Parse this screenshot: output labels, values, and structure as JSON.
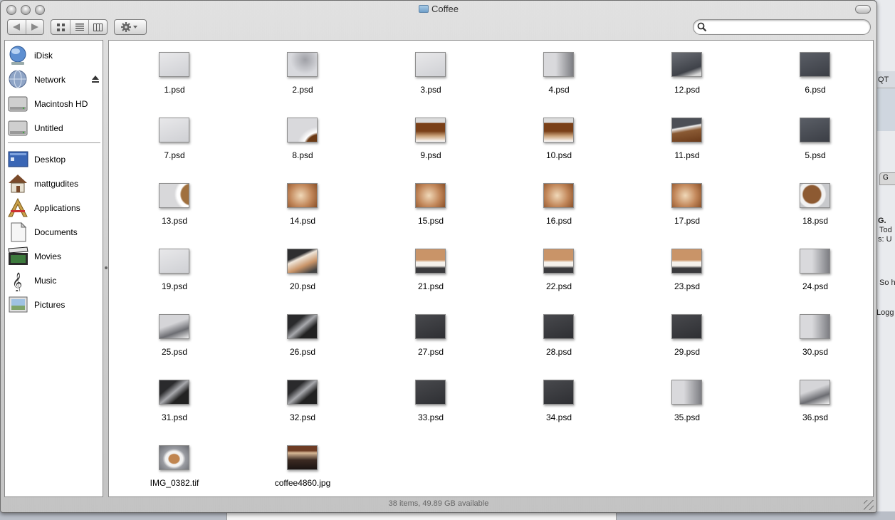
{
  "window": {
    "title": "Coffee",
    "status_text": "38 items, 49.89 GB available"
  },
  "toolbar": {
    "nav_icons": [
      "back-arrow-icon",
      "forward-arrow-icon"
    ],
    "view_icons": [
      "icon-view-icon",
      "list-view-icon",
      "column-view-icon"
    ],
    "action_icon": "gear-icon",
    "search_placeholder": "",
    "search_value": ""
  },
  "sidebar": {
    "devices": [
      {
        "label": "iDisk",
        "icon": "idisk-icon"
      },
      {
        "label": "Network",
        "icon": "network-globe-icon",
        "eject": true
      },
      {
        "label": "Macintosh HD",
        "icon": "hard-drive-icon"
      },
      {
        "label": "Untitled",
        "icon": "hard-drive-icon"
      }
    ],
    "places": [
      {
        "label": "Desktop",
        "icon": "desktop-icon"
      },
      {
        "label": "mattgudites",
        "icon": "home-icon"
      },
      {
        "label": "Applications",
        "icon": "applications-icon"
      },
      {
        "label": "Documents",
        "icon": "documents-icon"
      },
      {
        "label": "Movies",
        "icon": "movies-icon"
      },
      {
        "label": "Music",
        "icon": "music-icon"
      },
      {
        "label": "Pictures",
        "icon": "pictures-icon"
      }
    ]
  },
  "files": [
    {
      "name": "1.psd",
      "tone": "l"
    },
    {
      "name": "2.psd",
      "tone": "l2"
    },
    {
      "name": "3.psd",
      "tone": "l"
    },
    {
      "name": "4.psd",
      "tone": "m"
    },
    {
      "name": "12.psd",
      "tone": "g"
    },
    {
      "name": "6.psd",
      "tone": "d"
    },
    {
      "name": "7.psd",
      "tone": "l"
    },
    {
      "name": "8.psd",
      "tone": "cup"
    },
    {
      "name": "9.psd",
      "tone": "c"
    },
    {
      "name": "10.psd",
      "tone": "c"
    },
    {
      "name": "11.psd",
      "tone": "gc"
    },
    {
      "name": "5.psd",
      "tone": "d"
    },
    {
      "name": "13.psd",
      "tone": "lc"
    },
    {
      "name": "14.psd",
      "tone": "f"
    },
    {
      "name": "15.psd",
      "tone": "f"
    },
    {
      "name": "16.psd",
      "tone": "f"
    },
    {
      "name": "17.psd",
      "tone": "f"
    },
    {
      "name": "18.psd",
      "tone": "fc"
    },
    {
      "name": "19.psd",
      "tone": "l"
    },
    {
      "name": "20.psd",
      "tone": "dc"
    },
    {
      "name": "21.psd",
      "tone": "fb"
    },
    {
      "name": "22.psd",
      "tone": "fb"
    },
    {
      "name": "23.psd",
      "tone": "fb"
    },
    {
      "name": "24.psd",
      "tone": "m"
    },
    {
      "name": "25.psd",
      "tone": "lm"
    },
    {
      "name": "26.psd",
      "tone": "dm"
    },
    {
      "name": "27.psd",
      "tone": "dd"
    },
    {
      "name": "28.psd",
      "tone": "dd"
    },
    {
      "name": "29.psd",
      "tone": "dd"
    },
    {
      "name": "30.psd",
      "tone": "m"
    },
    {
      "name": "31.psd",
      "tone": "dm"
    },
    {
      "name": "32.psd",
      "tone": "dm"
    },
    {
      "name": "33.psd",
      "tone": "dd"
    },
    {
      "name": "34.psd",
      "tone": "dd"
    },
    {
      "name": "35.psd",
      "tone": "m"
    },
    {
      "name": "36.psd",
      "tone": "lm"
    },
    {
      "name": "IMG_0382.tif",
      "tone": "photo1"
    },
    {
      "name": "coffee4860.jpg",
      "tone": "photo2"
    }
  ],
  "background_fragments": {
    "right": [
      "QT",
      "G",
      "G.",
      "Tod",
      "s: U",
      "So h",
      "Logg"
    ]
  }
}
